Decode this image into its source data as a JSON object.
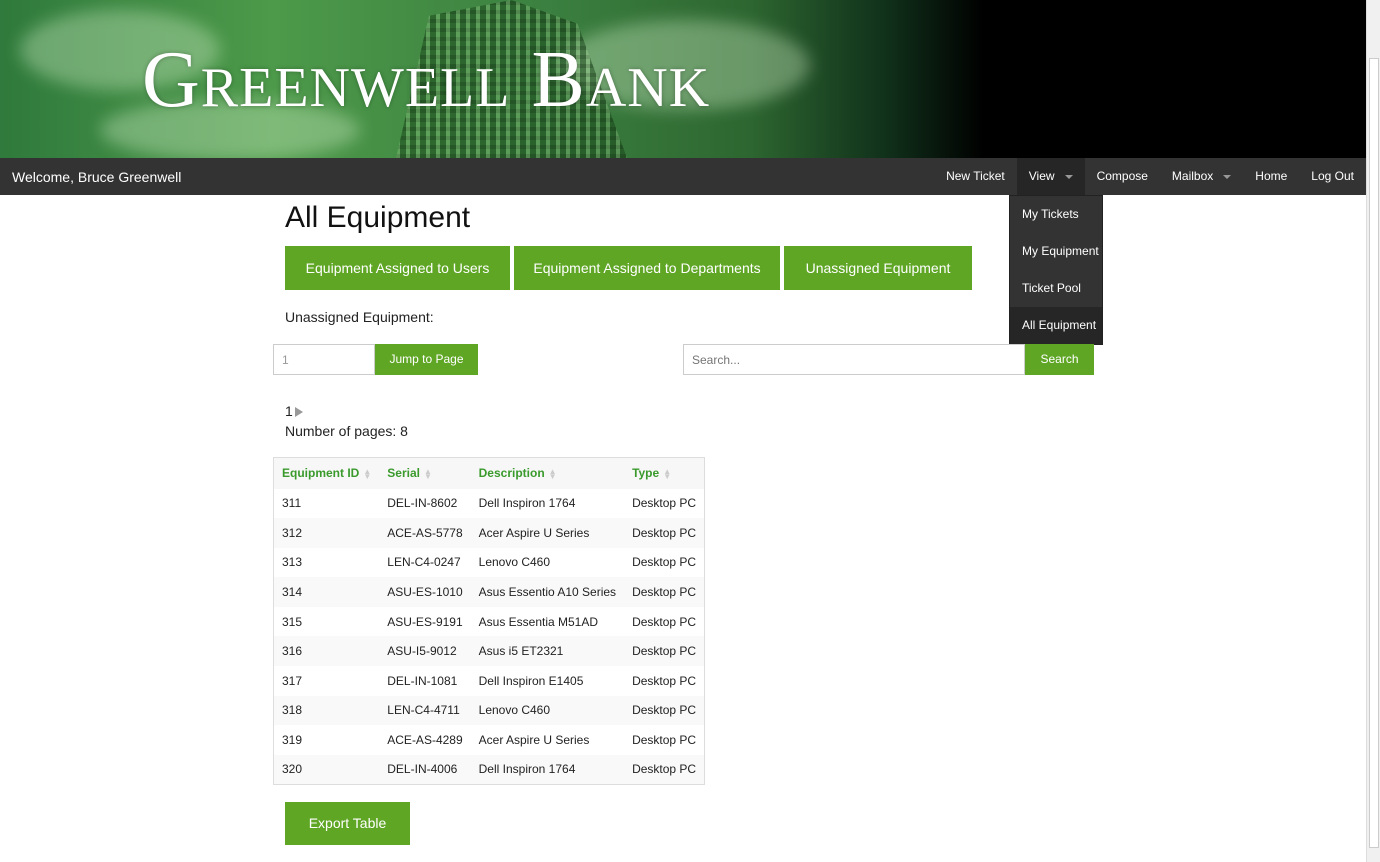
{
  "brand": {
    "logo": "Greenwell Bank",
    "welcome": "Welcome, Bruce Greenwell"
  },
  "nav": {
    "items": [
      {
        "label": "New Ticket"
      },
      {
        "label": "View",
        "dropdown": true
      },
      {
        "label": "Compose"
      },
      {
        "label": "Mailbox",
        "dropdown": true
      },
      {
        "label": "Home"
      },
      {
        "label": "Log Out"
      }
    ],
    "view_menu": [
      "My Tickets",
      "My Equipment",
      "Ticket Pool",
      "All Equipment"
    ]
  },
  "page": {
    "title": "All Equipment",
    "tabs": [
      "Equipment Assigned to Users",
      "Equipment Assigned to Departments",
      "Unassigned Equipment"
    ],
    "section_label": "Unassigned Equipment:",
    "page_input_value": "1",
    "jump_label": "Jump to Page",
    "search_placeholder": "Search...",
    "search_label": "Search",
    "current_page": "1",
    "num_pages_text": "Number of pages: 8",
    "export_label": "Export Table"
  },
  "colors": {
    "accent": "#5fa625",
    "nav_bg": "#333333",
    "header_text": "#3a9a2c"
  },
  "table": {
    "columns": [
      "Equipment ID",
      "Serial",
      "Description",
      "Type"
    ],
    "rows": [
      [
        "311",
        "DEL-IN-8602",
        "Dell Inspiron 1764",
        "Desktop PC"
      ],
      [
        "312",
        "ACE-AS-5778",
        "Acer Aspire U Series",
        "Desktop PC"
      ],
      [
        "313",
        "LEN-C4-0247",
        "Lenovo C460",
        "Desktop PC"
      ],
      [
        "314",
        "ASU-ES-1010",
        "Asus Essentio A10 Series",
        "Desktop PC"
      ],
      [
        "315",
        "ASU-ES-9191",
        "Asus Essentia M51AD",
        "Desktop PC"
      ],
      [
        "316",
        "ASU-I5-9012",
        "Asus i5 ET2321",
        "Desktop PC"
      ],
      [
        "317",
        "DEL-IN-1081",
        "Dell Inspiron E1405",
        "Desktop PC"
      ],
      [
        "318",
        "LEN-C4-4711",
        "Lenovo C460",
        "Desktop PC"
      ],
      [
        "319",
        "ACE-AS-4289",
        "Acer Aspire U Series",
        "Desktop PC"
      ],
      [
        "320",
        "DEL-IN-4006",
        "Dell Inspiron 1764",
        "Desktop PC"
      ]
    ]
  }
}
